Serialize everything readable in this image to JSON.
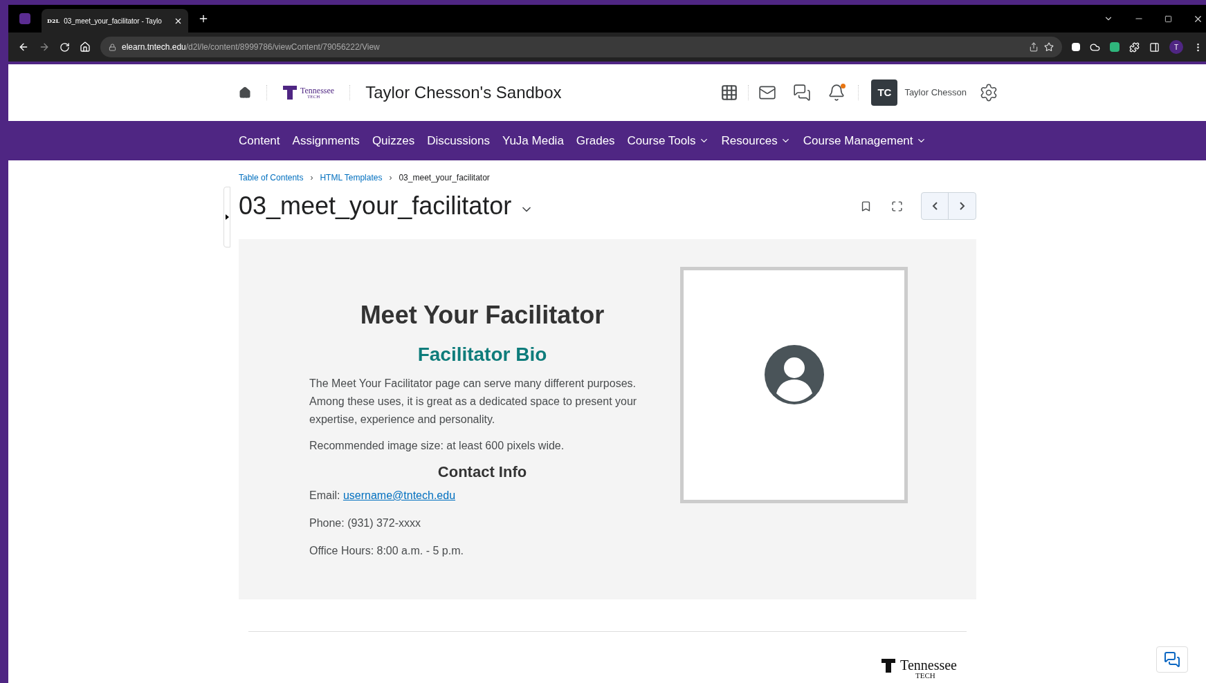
{
  "browser": {
    "tab_title": "03_meet_your_facilitator - Taylo",
    "tab_favicon": "D2L",
    "url_host": "elearn.tntech.edu",
    "url_path": "/d2l/le/content/8999786/viewContent/79056222/View",
    "profile_initial": "T"
  },
  "header": {
    "logo_name": "Tennessee",
    "logo_sub": "TECH",
    "course_title": "Taylor Chesson's Sandbox",
    "notification_badge": true,
    "user_initials": "TC",
    "user_name": "Taylor Chesson"
  },
  "nav": [
    {
      "label": "Content",
      "has_menu": false
    },
    {
      "label": "Assignments",
      "has_menu": false
    },
    {
      "label": "Quizzes",
      "has_menu": false
    },
    {
      "label": "Discussions",
      "has_menu": false
    },
    {
      "label": "YuJa Media",
      "has_menu": false
    },
    {
      "label": "Grades",
      "has_menu": false
    },
    {
      "label": "Course Tools",
      "has_menu": true
    },
    {
      "label": "Resources",
      "has_menu": true
    },
    {
      "label": "Course Management",
      "has_menu": true
    }
  ],
  "breadcrumbs": [
    {
      "label": "Table of Contents",
      "link": true
    },
    {
      "separator": "›",
      "label": "HTML Templates",
      "link": true
    },
    {
      "separator": "›",
      "label": "03_meet_your_facilitator",
      "link": false
    }
  ],
  "page_title": "03_meet_your_facilitator",
  "content": {
    "heading": "Meet Your Facilitator",
    "subheading": "Facilitator Bio",
    "paragraphs": [
      "The Meet Your Facilitator page can serve many different purposes. Among these uses, it is great as a dedicated space to present your expertise, experience and personality.",
      "Recommended image size: at least 600 pixels wide."
    ],
    "contact_heading": "Contact Info",
    "email_label": "Email:",
    "email": "username@tntech.edu",
    "contact_lines": [
      "Phone: (931) 372-xxxx",
      "Office Hours: 8:00 a.m. - 5 p.m."
    ]
  },
  "footer": {
    "logo_name": "Tennessee",
    "logo_sub": "TECH"
  }
}
